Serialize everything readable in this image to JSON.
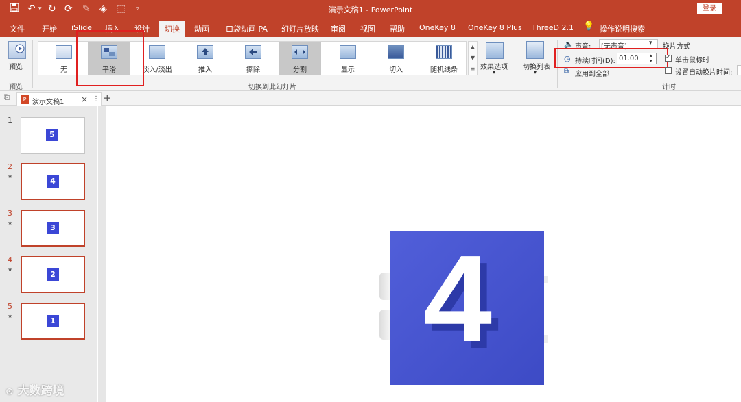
{
  "window": {
    "title": "演示文稿1 - PowerPoint",
    "login": "登录"
  },
  "menu": {
    "items": [
      "文件",
      "开始",
      "iSlide",
      "插入",
      "设计",
      "切换",
      "动画",
      "口袋动画 PA",
      "幻灯片放映",
      "审阅",
      "视图",
      "帮助",
      "OneKey 8",
      "OneKey 8 Plus",
      "ThreeD 2.1"
    ],
    "search": "操作说明搜索"
  },
  "ribbon": {
    "preview_label": "预览",
    "preview_group": "预览",
    "transitions": [
      "无",
      "平滑",
      "淡入/淡出",
      "推入",
      "擦除",
      "分割",
      "显示",
      "切入",
      "随机线条"
    ],
    "effect_options": "效果选项",
    "group_label": "切换到此幻灯片",
    "switch_list": "切换列表",
    "sound_label": "声音:",
    "sound_value": "[无声音]",
    "duration_label": "持续时间(D):",
    "duration_value": "01.00",
    "apply_all": "应用到全部",
    "advance_title": "换片方式",
    "on_click": "单击鼠标时",
    "after_label": "设置自动换片时间:",
    "timing_group": "计时"
  },
  "doc_tab": {
    "name": "演示文稿1"
  },
  "slides": [
    {
      "index": "1",
      "digit": "5",
      "animated": false
    },
    {
      "index": "2",
      "digit": "4",
      "animated": true
    },
    {
      "index": "3",
      "digit": "3",
      "animated": true
    },
    {
      "index": "4",
      "digit": "2",
      "animated": true
    },
    {
      "index": "5",
      "digit": "1",
      "animated": true
    }
  ],
  "main_slide": {
    "digit": "4"
  },
  "watermark": "大数跨境",
  "colors": {
    "accent": "#c0422a",
    "cube": "#4251d6",
    "highlight": "#e02020"
  }
}
